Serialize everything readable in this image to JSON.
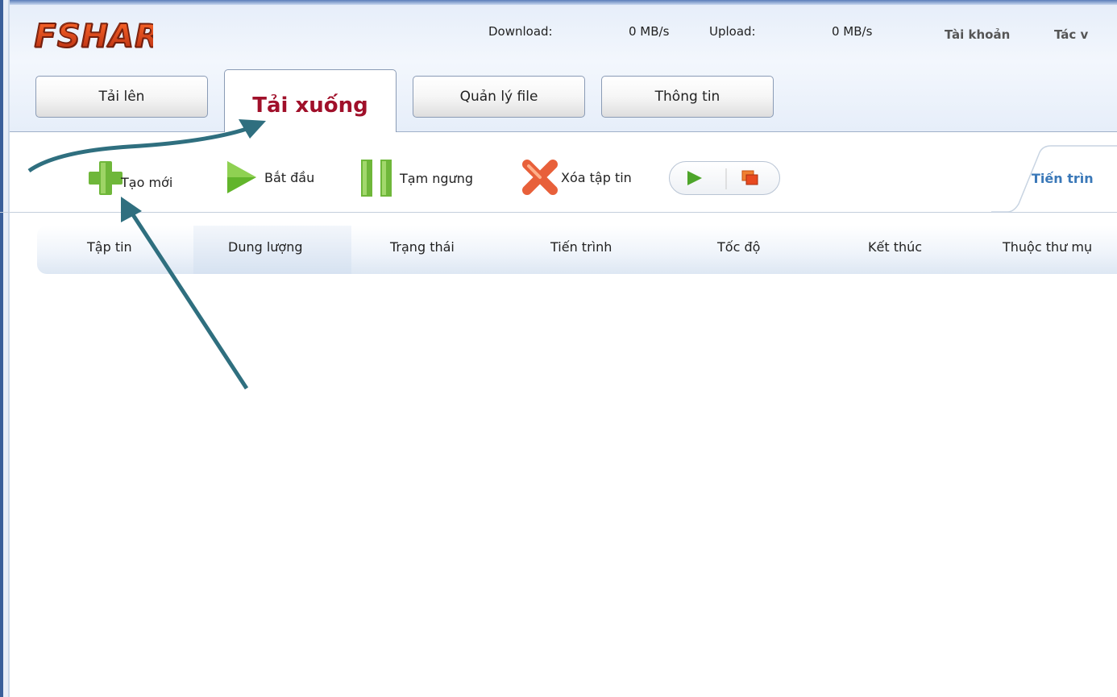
{
  "app": {
    "logo_text": "FSHARE"
  },
  "stats": {
    "download_label": "Download:",
    "download_value": "0 MB/s",
    "upload_label": "Upload:",
    "upload_value": "0 MB/s"
  },
  "top_links": {
    "account": "Tài khoản",
    "partial": "Tác v"
  },
  "tabs": [
    {
      "label": "Tải lên"
    },
    {
      "label": "Tải xuống",
      "active": true
    },
    {
      "label": "Quản lý file"
    },
    {
      "label": "Thông tin"
    }
  ],
  "toolbar": {
    "new": "Tạo mới",
    "start": "Bắt đầu",
    "pause": "Tạm ngưng",
    "delete": "Xóa tập tin",
    "progress_tab": "Tiến trìn"
  },
  "columns": [
    "Tập tin",
    "Dung lượng",
    "Trạng thái",
    "Tiến trình",
    "Tốc độ",
    "Kết thúc",
    "Thuộc thư mụ"
  ],
  "colors": {
    "accent": "#a0102a",
    "link": "#3a78b8",
    "annotation": "#2f6f7f"
  }
}
